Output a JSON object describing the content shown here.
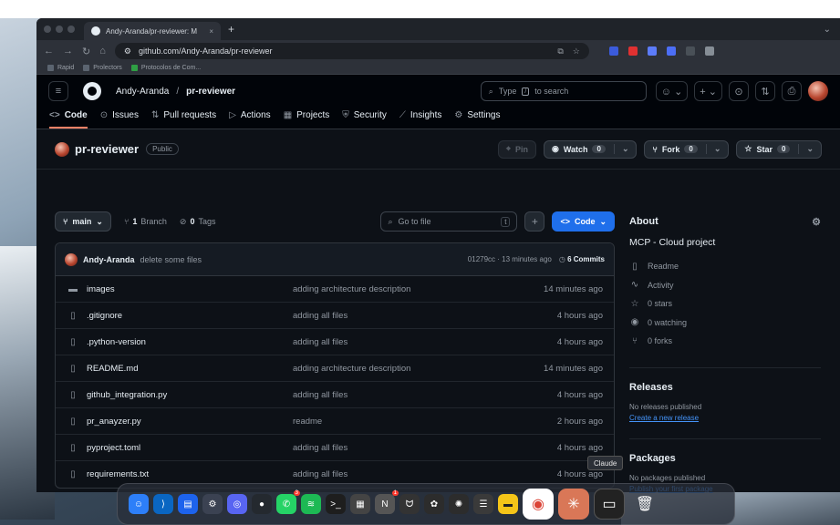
{
  "browser": {
    "tab_title": "Andy-Aranda/pr-reviewer: M",
    "url": "github.com/Andy-Aranda/pr-reviewer",
    "bookmarks": [
      "Rapid",
      "Prolectors",
      "Protocolos de Com..."
    ]
  },
  "header": {
    "owner": "Andy-Aranda",
    "separator": "/",
    "repo": "pr-reviewer",
    "search_prefix": "Type",
    "search_key": "/",
    "search_suffix": "to search"
  },
  "repo_nav": [
    {
      "icon": "<>",
      "label": "Code"
    },
    {
      "icon": "⊙",
      "label": "Issues"
    },
    {
      "icon": "⇅",
      "label": "Pull requests"
    },
    {
      "icon": "▷",
      "label": "Actions"
    },
    {
      "icon": "▦",
      "label": "Projects"
    },
    {
      "icon": "⛨",
      "label": "Security"
    },
    {
      "icon": "⟋",
      "label": "Insights"
    },
    {
      "icon": "⚙",
      "label": "Settings"
    }
  ],
  "repo_header": {
    "name": "pr-reviewer",
    "visibility": "Public",
    "pin_label": "Pin",
    "watch_label": "Watch",
    "watch_count": "0",
    "fork_label": "Fork",
    "fork_count": "0",
    "star_label": "Star",
    "star_count": "0"
  },
  "toolbar": {
    "branch": "main",
    "branch_count": "1",
    "branch_label": "Branch",
    "tag_count": "0",
    "tag_label": "Tags",
    "goto_placeholder": "Go to file",
    "goto_key": "t",
    "plus": "+",
    "code_label": "Code"
  },
  "commit": {
    "user": "Andy-Aranda",
    "message": "delete some files",
    "hash_time": "01279cc · 13 minutes ago",
    "commits_count": "6",
    "commits_label": "Commits"
  },
  "files": [
    {
      "type": "dir",
      "name": "images",
      "message": "adding architecture description",
      "time": "14 minutes ago"
    },
    {
      "type": "file",
      "name": ".gitignore",
      "message": "adding all files",
      "time": "4 hours ago"
    },
    {
      "type": "file",
      "name": ".python-version",
      "message": "adding all files",
      "time": "4 hours ago"
    },
    {
      "type": "file",
      "name": "README.md",
      "message": "adding architecture description",
      "time": "14 minutes ago"
    },
    {
      "type": "file",
      "name": "github_integration.py",
      "message": "adding all files",
      "time": "4 hours ago"
    },
    {
      "type": "file",
      "name": "pr_anayzer.py",
      "message": "readme",
      "time": "2 hours ago"
    },
    {
      "type": "file",
      "name": "pyproject.toml",
      "message": "adding all files",
      "time": "4 hours ago"
    },
    {
      "type": "file",
      "name": "requirements.txt",
      "message": "adding all files",
      "time": "4 hours ago"
    }
  ],
  "about": {
    "title": "About",
    "description": "MCP - Cloud project",
    "items": [
      {
        "icon": "book-icon",
        "label": "Readme"
      },
      {
        "icon": "pulse-icon",
        "label": "Activity"
      },
      {
        "icon": "star-icon",
        "label": "0 stars"
      },
      {
        "icon": "eye-icon",
        "label": "0 watching"
      },
      {
        "icon": "fork-icon",
        "label": "0 forks"
      }
    ]
  },
  "releases": {
    "title": "Releases",
    "empty": "No releases published",
    "link": "Create a new release"
  },
  "packages": {
    "title": "Packages",
    "empty": "No packages published",
    "link": "Publish your first package"
  },
  "tooltip": "Claude",
  "colors": {
    "accent_blue": "#1f6feb",
    "active_tab": "#f78166",
    "bg": "#0d1117"
  }
}
